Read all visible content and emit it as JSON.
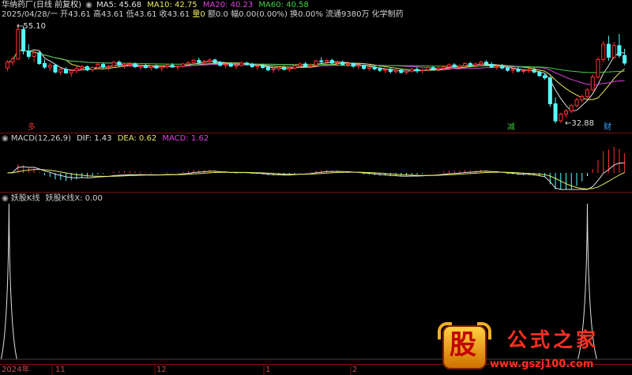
{
  "header": {
    "title": "华纳药厂(日线 前复权)",
    "ma": [
      {
        "label": "MA5: 45.68",
        "color": "#e0e0e0"
      },
      {
        "label": "MA10: 42.75",
        "color": "#e8e860"
      },
      {
        "label": "MA20: 40.23",
        "color": "#e040e0"
      },
      {
        "label": "MA60: 40.58",
        "color": "#40d040"
      }
    ],
    "info_prefix": "2025/04/28/一 开43.61 高43.61 低43.61 收43.61",
    "info_vol": "量0",
    "info_amt": "额0.0",
    "info_change": "幅0.00(0.00%)",
    "info_suffix": "换0.00% 流通9380万 化学制药"
  },
  "marks": {
    "high": "55.10",
    "low": "32.88",
    "tag_left": "多",
    "tag_mid": "减",
    "tag_right": "财"
  },
  "macd": {
    "title": "MACD(12,26,9)",
    "dif": "DIF: 1.43",
    "dea": "DEA: 0.62",
    "macd": "MACD: 1.62",
    "colors": {
      "dif": "#e0e0e0",
      "dea": "#e8e860",
      "macd": "#e040e0"
    }
  },
  "yaoguk": {
    "title": "妖股K线",
    "value": "妖股K线X: 0.00"
  },
  "timeline": {
    "labels": [
      "2024年",
      "11",
      "12",
      "1",
      "2"
    ]
  },
  "watermark": {
    "logo_text": "股",
    "name": "公式之家",
    "url": "www.gszj100.com"
  },
  "chart_data": {
    "type": "candlestick",
    "price_high": 55.1,
    "price_low": 32.88,
    "ohlc": [
      [
        45.2,
        47.0,
        44.5,
        46.5
      ],
      [
        46.5,
        47.8,
        45.8,
        47.2
      ],
      [
        47.2,
        55.1,
        47.0,
        53.8
      ],
      [
        53.8,
        54.6,
        48.2,
        49.0
      ],
      [
        49.0,
        50.5,
        47.2,
        47.8
      ],
      [
        47.8,
        49.2,
        46.5,
        48.6
      ],
      [
        48.6,
        48.9,
        45.9,
        46.2
      ],
      [
        46.2,
        47.1,
        45.0,
        45.4
      ],
      [
        45.4,
        46.3,
        44.6,
        45.8
      ],
      [
        45.8,
        46.0,
        44.0,
        44.3
      ],
      [
        44.3,
        45.2,
        43.6,
        44.9
      ],
      [
        44.9,
        45.4,
        43.9,
        44.1
      ],
      [
        44.1,
        44.8,
        43.2,
        44.6
      ],
      [
        44.6,
        45.5,
        44.0,
        45.1
      ],
      [
        45.1,
        45.9,
        44.6,
        45.5
      ],
      [
        45.5,
        45.8,
        44.5,
        44.8
      ],
      [
        44.8,
        45.6,
        44.3,
        45.3
      ],
      [
        45.3,
        46.4,
        45.0,
        46.0
      ],
      [
        46.0,
        46.3,
        45.1,
        45.4
      ],
      [
        45.4,
        45.9,
        44.7,
        45.6
      ],
      [
        45.6,
        46.8,
        45.3,
        46.5
      ],
      [
        46.5,
        46.9,
        45.5,
        45.8
      ],
      [
        45.8,
        46.2,
        45.0,
        45.9
      ],
      [
        45.9,
        46.5,
        45.4,
        46.1
      ],
      [
        46.1,
        46.4,
        45.2,
        45.5
      ],
      [
        45.5,
        46.0,
        44.8,
        45.7
      ],
      [
        45.7,
        46.2,
        45.1,
        45.3
      ],
      [
        45.3,
        45.8,
        44.6,
        45.6
      ],
      [
        45.6,
        46.0,
        45.0,
        45.2
      ],
      [
        45.2,
        45.7,
        44.5,
        45.5
      ],
      [
        45.5,
        46.1,
        45.1,
        45.8
      ],
      [
        45.8,
        46.3,
        45.3,
        45.4
      ],
      [
        45.4,
        45.9,
        44.7,
        45.6
      ],
      [
        45.6,
        46.4,
        45.2,
        46.1
      ],
      [
        46.1,
        46.7,
        45.6,
        46.4
      ],
      [
        46.4,
        47.2,
        46.0,
        46.9
      ],
      [
        46.9,
        47.5,
        46.2,
        46.5
      ],
      [
        46.5,
        47.0,
        45.8,
        46.7
      ],
      [
        46.7,
        47.4,
        46.3,
        47.0
      ],
      [
        47.0,
        47.3,
        46.1,
        46.4
      ],
      [
        46.4,
        46.8,
        45.5,
        45.8
      ],
      [
        45.8,
        46.3,
        45.2,
        46.0
      ],
      [
        46.0,
        46.5,
        45.4,
        45.6
      ],
      [
        45.6,
        46.1,
        44.9,
        45.8
      ],
      [
        45.8,
        46.7,
        45.5,
        46.3
      ],
      [
        46.3,
        46.6,
        45.7,
        46.0
      ],
      [
        46.0,
        46.4,
        45.2,
        45.5
      ],
      [
        45.5,
        46.0,
        44.8,
        45.7
      ],
      [
        45.7,
        46.2,
        45.0,
        45.3
      ],
      [
        45.3,
        45.8,
        44.5,
        44.8
      ],
      [
        44.8,
        45.3,
        44.1,
        45.0
      ],
      [
        45.0,
        45.6,
        44.5,
        45.3
      ],
      [
        45.3,
        45.7,
        44.6,
        44.9
      ],
      [
        44.9,
        45.5,
        44.3,
        45.2
      ],
      [
        45.2,
        46.0,
        44.9,
        45.7
      ],
      [
        45.7,
        46.4,
        45.3,
        46.1
      ],
      [
        46.1,
        46.5,
        45.4,
        45.6
      ],
      [
        45.6,
        46.2,
        45.1,
        45.9
      ],
      [
        45.9,
        47.0,
        45.7,
        46.8
      ],
      [
        46.8,
        47.6,
        46.3,
        46.6
      ],
      [
        46.6,
        47.1,
        45.9,
        46.9
      ],
      [
        46.9,
        47.3,
        46.0,
        46.3
      ],
      [
        46.3,
        46.8,
        45.6,
        46.5
      ],
      [
        46.5,
        46.9,
        45.7,
        46.0
      ],
      [
        46.0,
        46.6,
        45.4,
        46.2
      ],
      [
        46.2,
        46.5,
        45.3,
        45.6
      ],
      [
        45.6,
        46.1,
        44.9,
        45.8
      ],
      [
        45.8,
        46.0,
        44.8,
        45.1
      ],
      [
        45.1,
        45.7,
        44.6,
        45.4
      ],
      [
        45.4,
        45.8,
        44.7,
        45.0
      ],
      [
        45.0,
        45.5,
        44.3,
        44.7
      ],
      [
        44.7,
        45.3,
        44.1,
        44.9
      ],
      [
        44.9,
        45.2,
        44.0,
        44.4
      ],
      [
        44.4,
        45.0,
        43.9,
        44.7
      ],
      [
        44.7,
        45.1,
        44.0,
        44.2
      ],
      [
        44.2,
        44.8,
        43.7,
        44.5
      ],
      [
        44.5,
        45.3,
        44.2,
        44.9
      ],
      [
        44.9,
        45.4,
        44.1,
        44.6
      ],
      [
        44.6,
        45.1,
        44.0,
        44.8
      ],
      [
        44.8,
        45.6,
        44.5,
        45.3
      ],
      [
        45.3,
        45.7,
        44.6,
        44.9
      ],
      [
        44.9,
        45.5,
        44.4,
        45.2
      ],
      [
        45.2,
        45.8,
        44.7,
        45.5
      ],
      [
        45.5,
        46.2,
        45.1,
        45.9
      ],
      [
        45.9,
        46.3,
        45.2,
        45.4
      ],
      [
        45.4,
        46.0,
        44.9,
        45.7
      ],
      [
        45.7,
        46.5,
        45.4,
        46.2
      ],
      [
        46.2,
        46.6,
        45.5,
        45.8
      ],
      [
        45.8,
        46.4,
        45.3,
        46.1
      ],
      [
        46.1,
        46.8,
        45.7,
        46.5
      ],
      [
        46.5,
        46.9,
        45.8,
        46.0
      ],
      [
        46.0,
        46.5,
        45.2,
        45.4
      ],
      [
        45.4,
        45.9,
        44.8,
        45.6
      ],
      [
        45.6,
        46.1,
        44.9,
        45.2
      ],
      [
        45.2,
        45.6,
        44.4,
        44.7
      ],
      [
        44.7,
        45.2,
        44.0,
        44.9
      ],
      [
        44.9,
        45.4,
        44.2,
        44.5
      ],
      [
        44.5,
        45.0,
        43.9,
        44.6
      ],
      [
        44.6,
        45.2,
        44.1,
        44.8
      ],
      [
        44.8,
        45.3,
        44.0,
        44.3
      ],
      [
        44.3,
        44.6,
        43.2,
        43.5
      ],
      [
        43.5,
        44.0,
        42.6,
        43.0
      ],
      [
        43.0,
        43.4,
        36.5,
        37.2
      ],
      [
        37.2,
        38.6,
        32.88,
        33.4
      ],
      [
        33.4,
        35.2,
        33.0,
        34.9
      ],
      [
        34.9,
        36.0,
        34.2,
        35.6
      ],
      [
        35.6,
        37.2,
        35.1,
        36.8
      ],
      [
        36.8,
        38.5,
        36.4,
        38.1
      ],
      [
        38.1,
        39.3,
        37.5,
        38.8
      ],
      [
        38.8,
        40.7,
        38.4,
        40.3
      ],
      [
        40.3,
        43.8,
        40.0,
        43.2
      ],
      [
        43.2,
        47.6,
        42.8,
        47.1
      ],
      [
        47.1,
        51.2,
        46.5,
        50.5
      ],
      [
        50.5,
        52.4,
        46.8,
        47.6
      ],
      [
        47.6,
        51.0,
        47.2,
        50.2
      ],
      [
        50.2,
        52.8,
        47.5,
        48.0
      ],
      [
        48.0,
        49.5,
        45.8,
        46.3
      ]
    ],
    "ma_periods": [
      5,
      10,
      20,
      60
    ],
    "macd_params": [
      12,
      26,
      9
    ],
    "dif_last": 1.43,
    "dea_last": 0.62,
    "macd_last": 1.62,
    "yaoguk_x_last": 0.0,
    "x_labels": [
      "2024年",
      "11",
      "12",
      "1",
      "2"
    ]
  }
}
